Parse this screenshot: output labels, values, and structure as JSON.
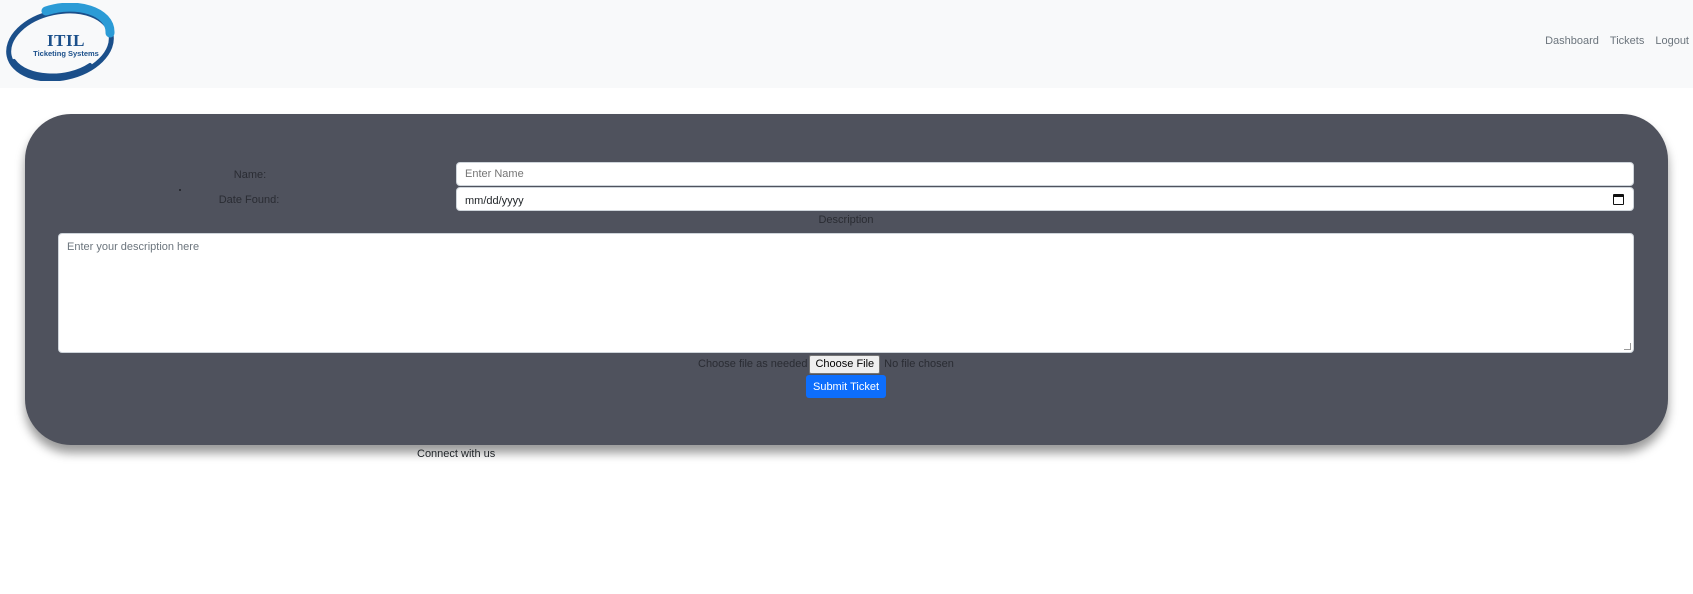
{
  "brand": {
    "line1": "ITIL",
    "line2": "Ticketing Systems",
    "colors": {
      "primary": "#1b4f8a",
      "light": "#2b9bd6"
    }
  },
  "nav": {
    "items": [
      {
        "label": "Dashboard"
      },
      {
        "label": "Tickets"
      },
      {
        "label": "Logout"
      }
    ]
  },
  "form": {
    "name_label": "Name:",
    "name_placeholder": "Enter Name",
    "date_label": "Date Found:",
    "date_placeholder": "mm/dd/yyyy",
    "description_label": "Description",
    "description_placeholder": "Enter your description here",
    "file_label": "Choose file as needed",
    "file_button": "Choose File",
    "file_status": "No file chosen",
    "submit_label": "Submit Ticket",
    "colors": {
      "card": "#4f525d",
      "submit": "#0d6efd"
    }
  },
  "footer": {
    "connect_text": "Connect with us"
  }
}
